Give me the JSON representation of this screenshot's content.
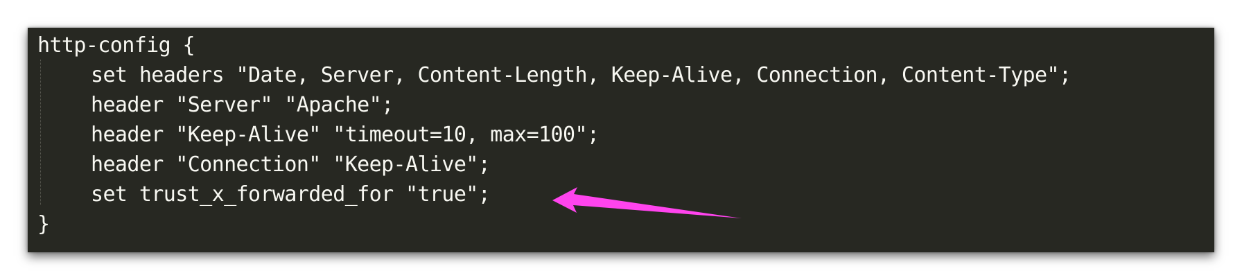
{
  "editor": {
    "theme_background": "#272822",
    "text_color": "#f8f8f2",
    "lines": [
      "http-config {",
      "set headers \"Date, Server, Content-Length, Keep-Alive, Connection, Content-Type\";",
      "header \"Server\" \"Apache\";",
      "header \"Keep-Alive\" \"timeout=10, max=100\";",
      "header \"Connection\" \"Keep-Alive\";",
      "set trust_x_forwarded_for \"true\";",
      "}"
    ]
  },
  "annotation": {
    "arrow_color": "#ff44ee",
    "points_to_line": 6
  }
}
